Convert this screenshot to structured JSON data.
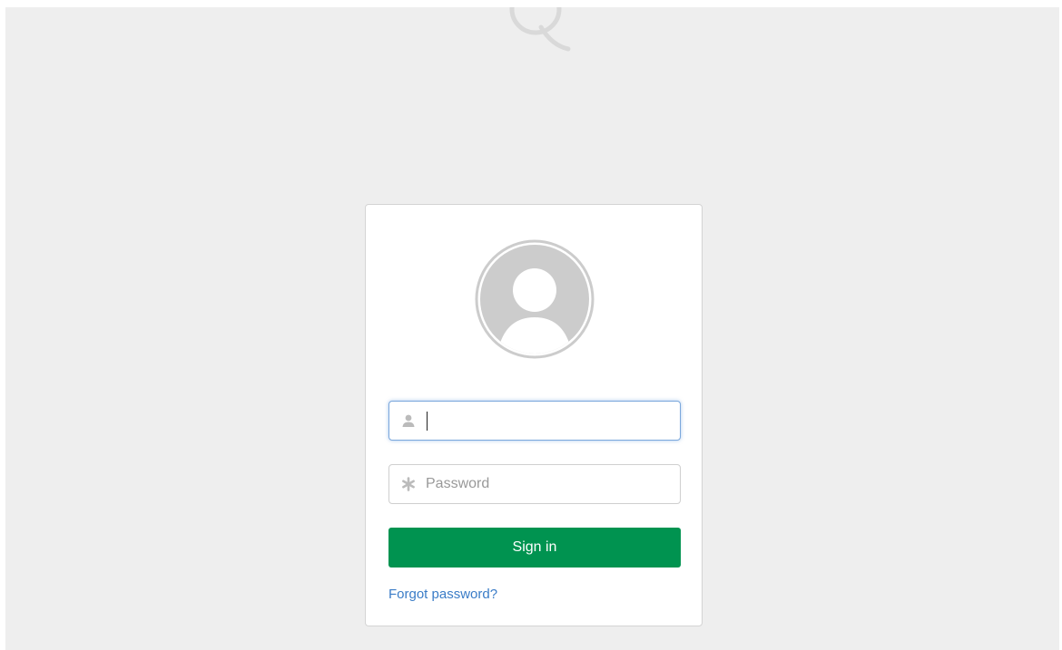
{
  "login": {
    "username": {
      "value": "",
      "placeholder": "",
      "focused": true
    },
    "password": {
      "value": "",
      "placeholder": "Password"
    },
    "signin_label": "Sign in",
    "forgot_label": "Forgot password?"
  },
  "colors": {
    "background": "#eeeeee",
    "card": "#ffffff",
    "primary_button": "#009350",
    "link": "#3a7cc7",
    "focus_border": "#7aa7dc"
  },
  "icons": {
    "logo": "q-logo-icon",
    "avatar": "user-avatar-icon",
    "username": "user-icon",
    "password": "asterisk-icon"
  }
}
